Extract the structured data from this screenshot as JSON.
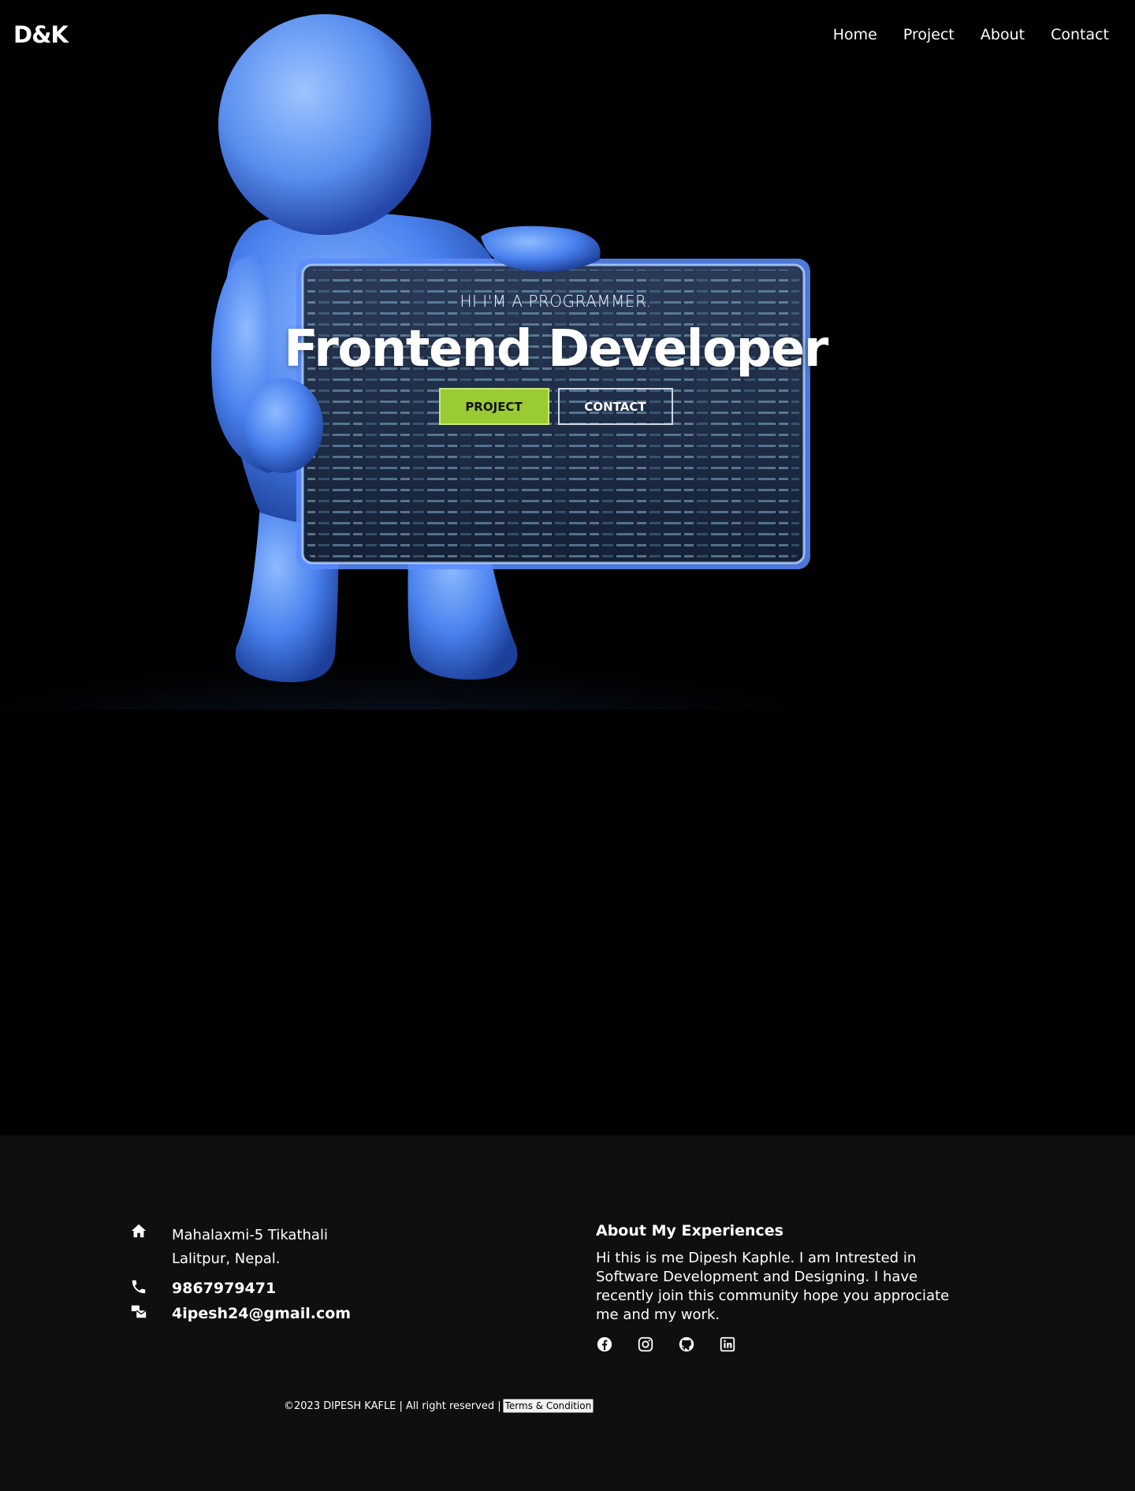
{
  "brand": {
    "logo": "D&K"
  },
  "nav": {
    "items": [
      {
        "label": "Home"
      },
      {
        "label": "Project"
      },
      {
        "label": "About"
      },
      {
        "label": "Contact"
      }
    ]
  },
  "hero": {
    "subtitle": "HI I'M A PROGRAMMER.",
    "title": "Frontend Developer",
    "buttons": {
      "project": "PROJECT",
      "contact": "CONTACT"
    },
    "colors": {
      "accent": "#9acb32",
      "figure": "#4d8cff"
    }
  },
  "footer": {
    "address": {
      "line1": "Mahalaxmi-5 Tikathali",
      "line2": "Lalitpur, Nepal."
    },
    "phone": "9867979471",
    "email": "4ipesh24@gmail.com",
    "about": {
      "title": "About My Experiences",
      "text": "Hi this is me Dipesh Kaphle. I am Intrested in Software Development and Designing. I have recently join this community hope you approciate me and my work."
    },
    "socials": [
      "facebook-icon",
      "instagram-icon",
      "github-icon",
      "linkedin-icon"
    ],
    "copyright": "©2023 DIPESH KAFLE | All right reserved |",
    "terms": "Terms & Condition"
  }
}
